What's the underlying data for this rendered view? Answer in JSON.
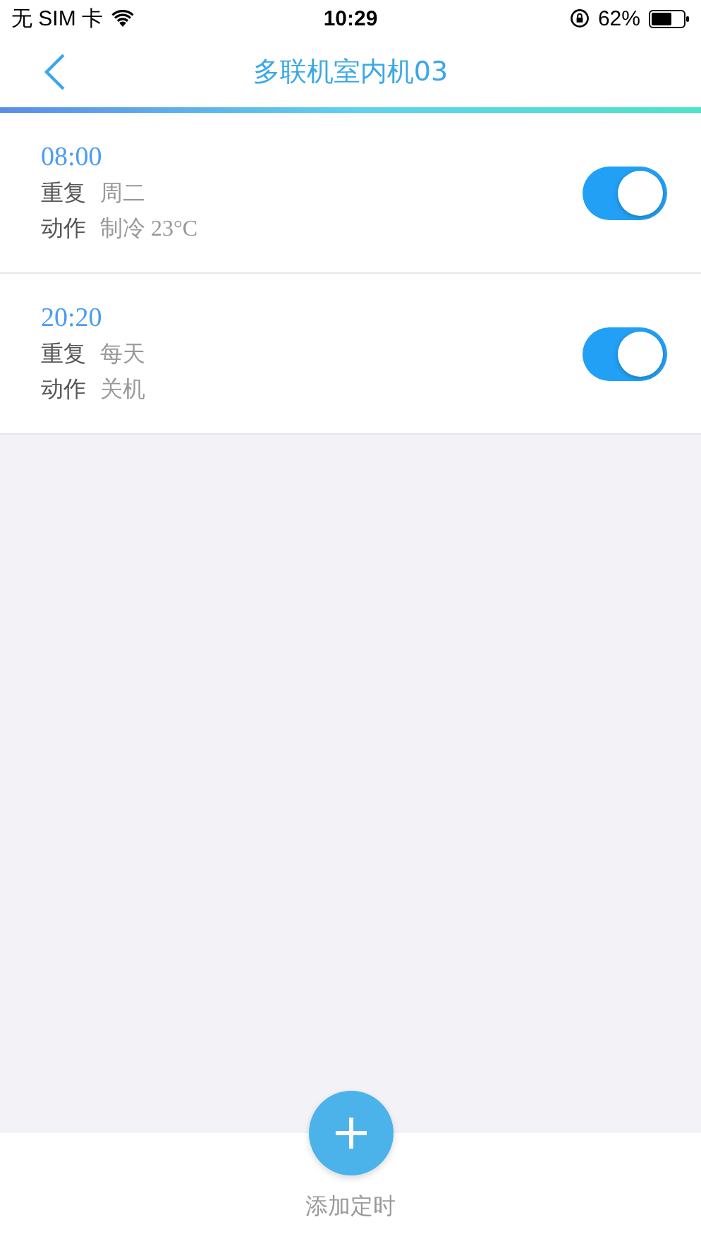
{
  "status_bar": {
    "carrier": "无 SIM 卡",
    "time": "10:29",
    "battery": "62%"
  },
  "nav": {
    "title": "多联机室内机03"
  },
  "timers": [
    {
      "time": "08:00",
      "repeat_label": "重复",
      "repeat": "周二",
      "action_label": "动作",
      "action": "制冷 23°C",
      "on": true
    },
    {
      "time": "20:20",
      "repeat_label": "重复",
      "repeat": "每天",
      "action_label": "动作",
      "action": "关机",
      "on": true
    }
  ],
  "add_button": {
    "label": "添加定时"
  }
}
